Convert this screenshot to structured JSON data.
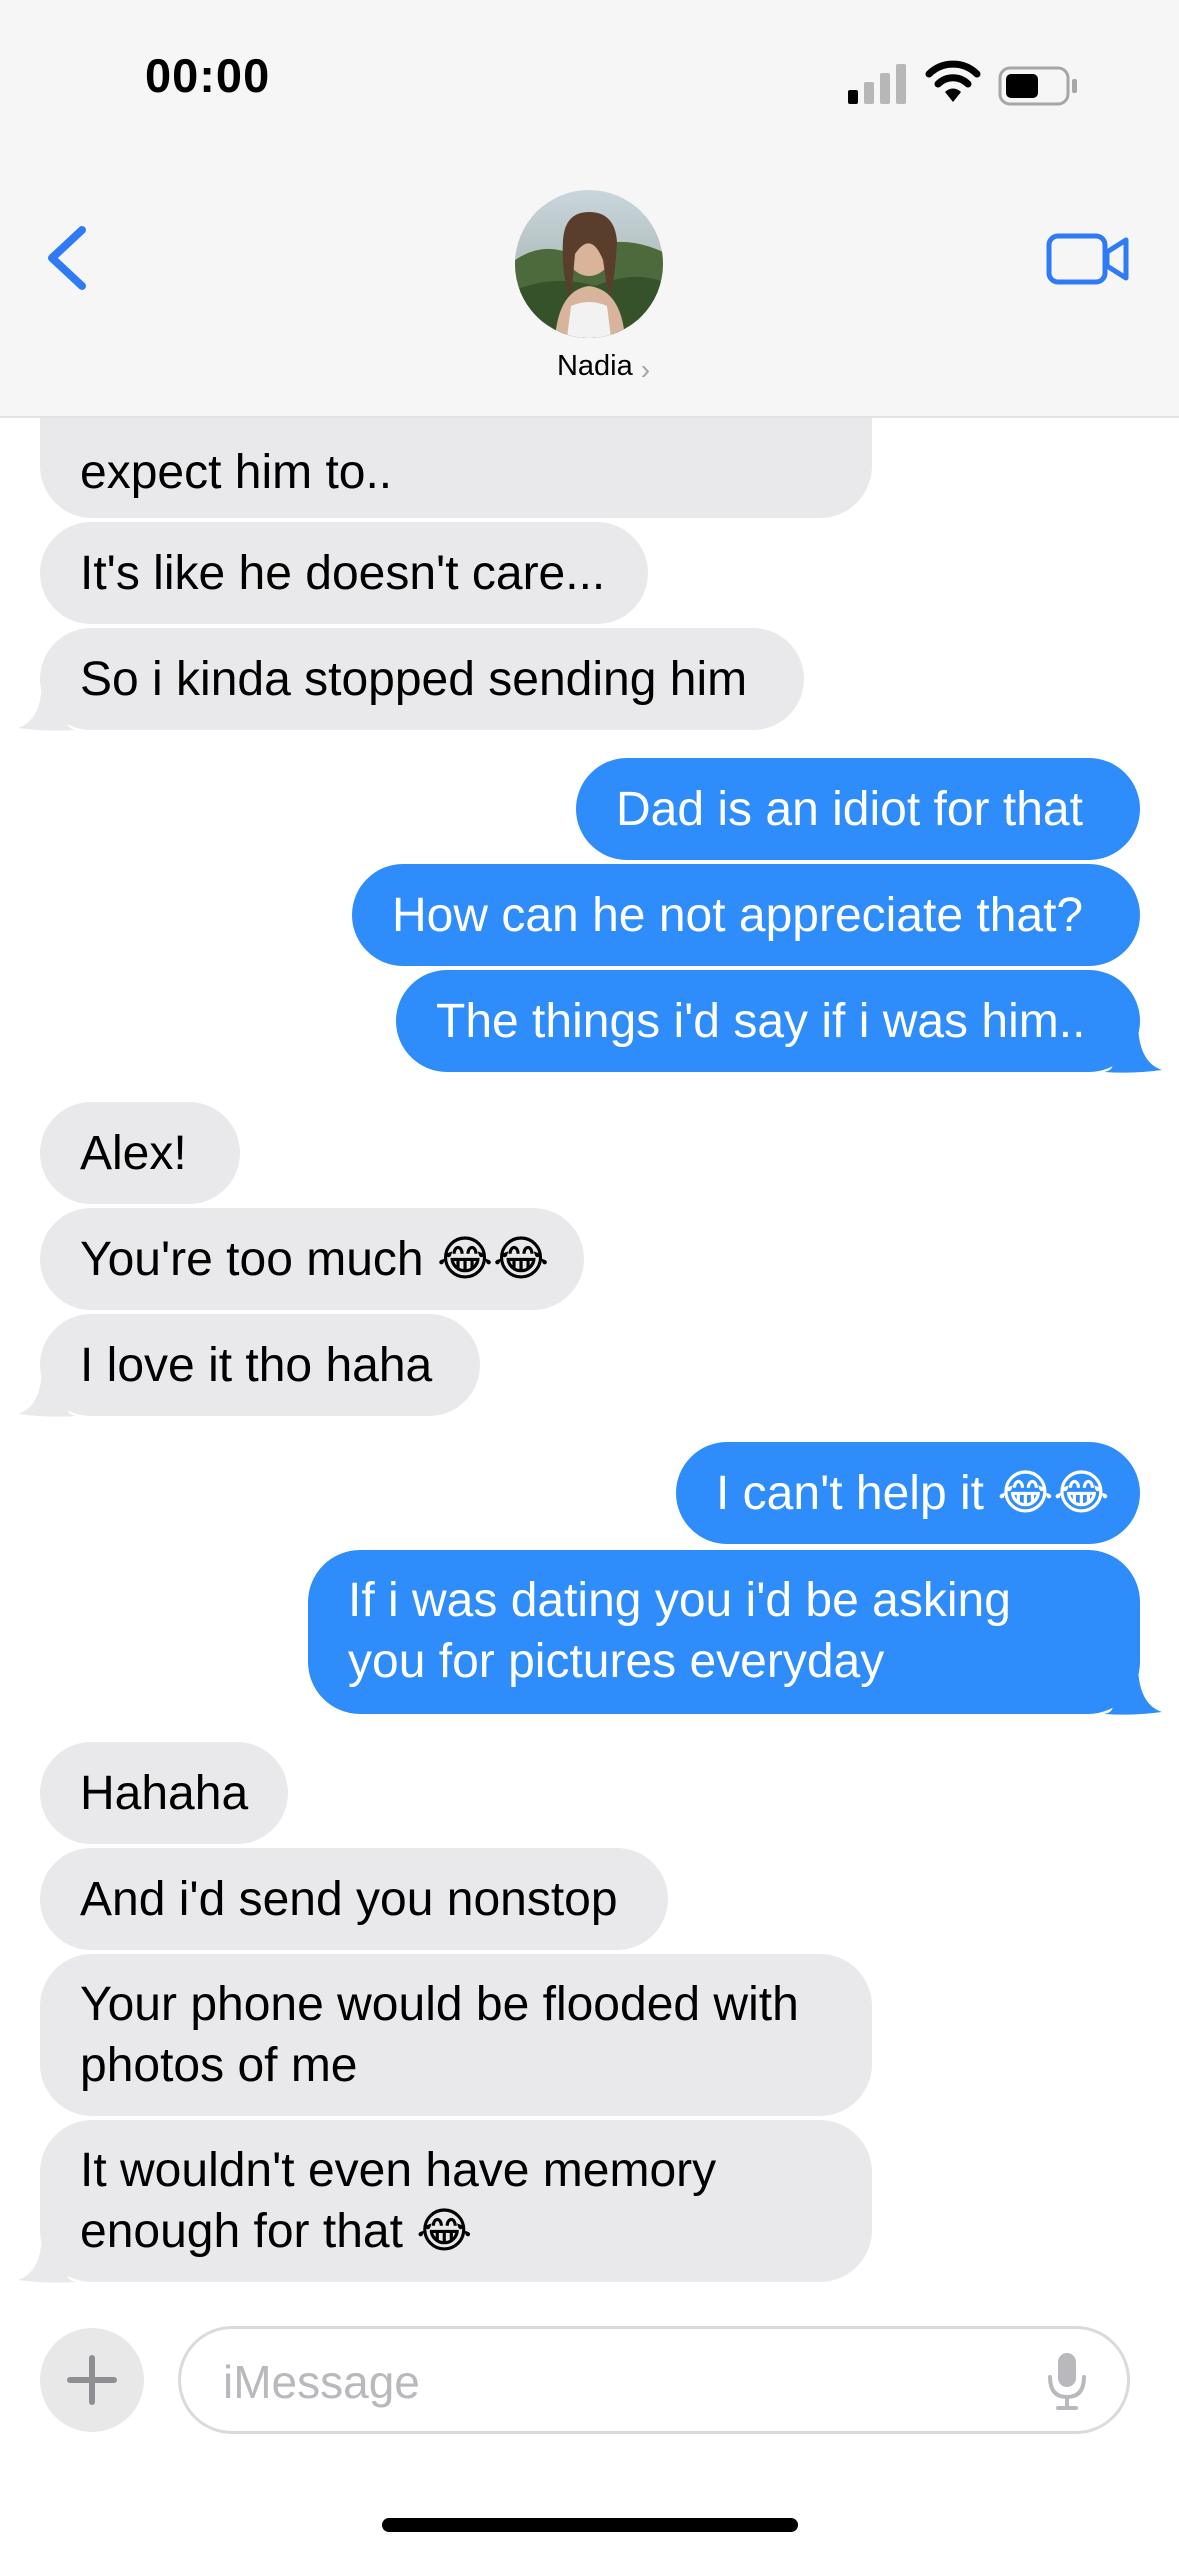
{
  "status_bar": {
    "time": "00:00"
  },
  "contact": {
    "name": "Nadia",
    "chevron": "›"
  },
  "messages": [
    {
      "from": "them",
      "text": "expect him to.."
    },
    {
      "from": "them",
      "text": "It's like he doesn't care..."
    },
    {
      "from": "them",
      "text": "So i kinda stopped sending him"
    },
    {
      "from": "me",
      "text": "Dad is an idiot for that"
    },
    {
      "from": "me",
      "text": "How can he not appreciate that?"
    },
    {
      "from": "me",
      "text": "The things i'd say if i was him.."
    },
    {
      "from": "them",
      "text": "Alex!"
    },
    {
      "from": "them",
      "text": "You're too much 😂😂"
    },
    {
      "from": "them",
      "text": "I love it tho haha"
    },
    {
      "from": "me",
      "text": "I can't help it 😂😂"
    },
    {
      "from": "me",
      "text": "If i was dating you i'd be asking you for pictures everyday"
    },
    {
      "from": "them",
      "text": "Hahaha"
    },
    {
      "from": "them",
      "text": "And i'd send you nonstop"
    },
    {
      "from": "them",
      "text": "Your phone would be flooded with photos of me"
    },
    {
      "from": "them",
      "text": "It wouldn't even have memory enough for that 😂"
    }
  ],
  "composer": {
    "placeholder": "iMessage",
    "value": ""
  },
  "colors": {
    "outgoing_bubble": "#2e8dfa",
    "incoming_bubble": "#e9e9eb",
    "accent": "#2f7bf5"
  },
  "icons": [
    "back-chevron-icon",
    "video-camera-icon",
    "plus-icon",
    "microphone-icon",
    "signal-icon",
    "wifi-icon",
    "battery-icon"
  ]
}
